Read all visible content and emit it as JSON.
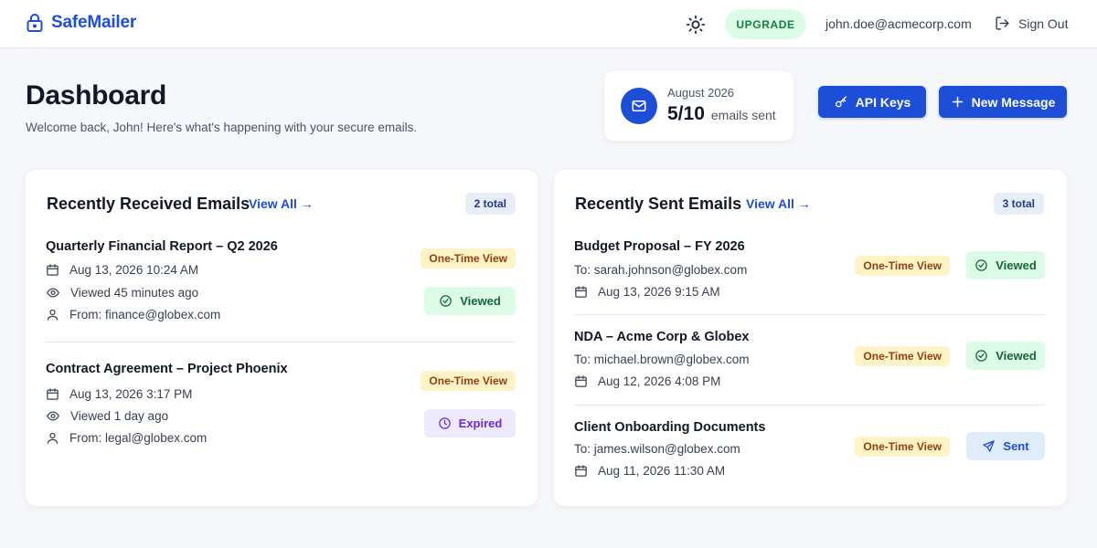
{
  "brand": {
    "name": "SafeMailer",
    "accent": "#1d4ed8"
  },
  "topbar": {
    "upgrade_label": "UPGRADE",
    "user_email": "john.doe@acmecorp.com",
    "signout_label": "Sign Out"
  },
  "header": {
    "title": "Dashboard",
    "subtitle": "Welcome back, John! Here's what's happening with your secure emails."
  },
  "usage": {
    "month": "August 2026",
    "count": "5/10",
    "label": "emails sent"
  },
  "actions": {
    "api_keys_label": "API Keys",
    "new_message_label": "New Message"
  },
  "received": {
    "title": "Recently Received Emails",
    "view_all": "View All →",
    "total": "2 total",
    "items": [
      {
        "subject": "Quarterly Financial Report – Q2 2026",
        "date": "Aug 13, 2026 10:24 AM",
        "viewed": "Viewed 45 minutes ago",
        "from": "From: finance@globex.com",
        "type_badge": "One-Time View",
        "status": "Viewed"
      },
      {
        "subject": "Contract Agreement – Project Phoenix",
        "date": "Aug 13, 2026 3:17 PM",
        "viewed": "Viewed 1 day ago",
        "from": "From: legal@globex.com",
        "type_badge": "One-Time View",
        "status": "Expired"
      }
    ]
  },
  "sent": {
    "title": "Recently Sent Emails",
    "view_all": "View All →",
    "total": "3 total",
    "items": [
      {
        "subject": "Budget Proposal – FY 2026",
        "to": "To: sarah.johnson@globex.com",
        "date": "Aug 13, 2026 9:15 AM",
        "type_badge": "One-Time View",
        "status": "Viewed"
      },
      {
        "subject": "NDA – Acme Corp & Globex",
        "to": "To: michael.brown@globex.com",
        "date": "Aug 12, 2026 4:08 PM",
        "type_badge": "One-Time View",
        "status": "Viewed"
      },
      {
        "subject": "Client Onboarding Documents",
        "to": "To: james.wilson@globex.com",
        "date": "Aug 11, 2026 11:30 AM",
        "type_badge": "One-Time View",
        "status": "Sent"
      }
    ]
  },
  "icons": {
    "brand": "lock-icon",
    "theme": "sun-icon",
    "signout": "sign-out-icon",
    "usage": "mail-icon",
    "api": "key-icon",
    "new": "plus-icon",
    "date": "calendar-icon",
    "viewed": "eye-icon",
    "from": "user-icon",
    "status_viewed": "check-circle-icon",
    "status_expired": "clock-icon",
    "status_sent": "send-icon"
  }
}
